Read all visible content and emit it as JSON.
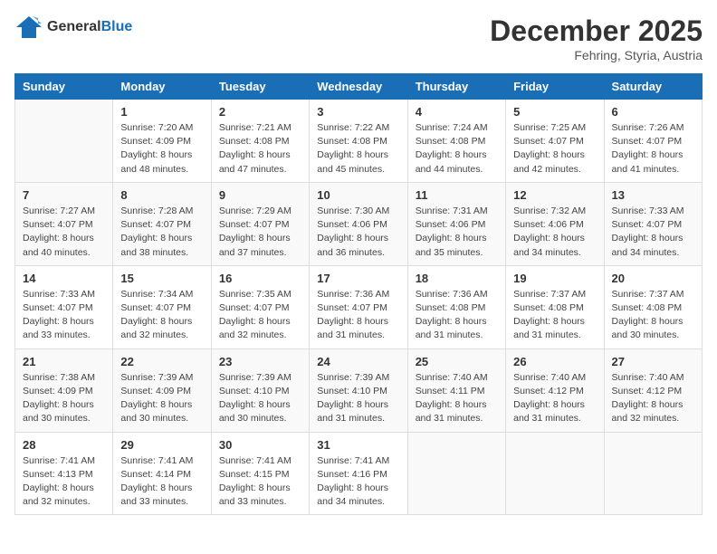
{
  "logo": {
    "general": "General",
    "blue": "Blue"
  },
  "title": "December 2025",
  "location": "Fehring, Styria, Austria",
  "days_header": [
    "Sunday",
    "Monday",
    "Tuesday",
    "Wednesday",
    "Thursday",
    "Friday",
    "Saturday"
  ],
  "weeks": [
    [
      {
        "num": "",
        "sunrise": "",
        "sunset": "",
        "daylight": ""
      },
      {
        "num": "1",
        "sunrise": "Sunrise: 7:20 AM",
        "sunset": "Sunset: 4:09 PM",
        "daylight": "Daylight: 8 hours and 48 minutes."
      },
      {
        "num": "2",
        "sunrise": "Sunrise: 7:21 AM",
        "sunset": "Sunset: 4:08 PM",
        "daylight": "Daylight: 8 hours and 47 minutes."
      },
      {
        "num": "3",
        "sunrise": "Sunrise: 7:22 AM",
        "sunset": "Sunset: 4:08 PM",
        "daylight": "Daylight: 8 hours and 45 minutes."
      },
      {
        "num": "4",
        "sunrise": "Sunrise: 7:24 AM",
        "sunset": "Sunset: 4:08 PM",
        "daylight": "Daylight: 8 hours and 44 minutes."
      },
      {
        "num": "5",
        "sunrise": "Sunrise: 7:25 AM",
        "sunset": "Sunset: 4:07 PM",
        "daylight": "Daylight: 8 hours and 42 minutes."
      },
      {
        "num": "6",
        "sunrise": "Sunrise: 7:26 AM",
        "sunset": "Sunset: 4:07 PM",
        "daylight": "Daylight: 8 hours and 41 minutes."
      }
    ],
    [
      {
        "num": "7",
        "sunrise": "Sunrise: 7:27 AM",
        "sunset": "Sunset: 4:07 PM",
        "daylight": "Daylight: 8 hours and 40 minutes."
      },
      {
        "num": "8",
        "sunrise": "Sunrise: 7:28 AM",
        "sunset": "Sunset: 4:07 PM",
        "daylight": "Daylight: 8 hours and 38 minutes."
      },
      {
        "num": "9",
        "sunrise": "Sunrise: 7:29 AM",
        "sunset": "Sunset: 4:07 PM",
        "daylight": "Daylight: 8 hours and 37 minutes."
      },
      {
        "num": "10",
        "sunrise": "Sunrise: 7:30 AM",
        "sunset": "Sunset: 4:06 PM",
        "daylight": "Daylight: 8 hours and 36 minutes."
      },
      {
        "num": "11",
        "sunrise": "Sunrise: 7:31 AM",
        "sunset": "Sunset: 4:06 PM",
        "daylight": "Daylight: 8 hours and 35 minutes."
      },
      {
        "num": "12",
        "sunrise": "Sunrise: 7:32 AM",
        "sunset": "Sunset: 4:06 PM",
        "daylight": "Daylight: 8 hours and 34 minutes."
      },
      {
        "num": "13",
        "sunrise": "Sunrise: 7:33 AM",
        "sunset": "Sunset: 4:07 PM",
        "daylight": "Daylight: 8 hours and 34 minutes."
      }
    ],
    [
      {
        "num": "14",
        "sunrise": "Sunrise: 7:33 AM",
        "sunset": "Sunset: 4:07 PM",
        "daylight": "Daylight: 8 hours and 33 minutes."
      },
      {
        "num": "15",
        "sunrise": "Sunrise: 7:34 AM",
        "sunset": "Sunset: 4:07 PM",
        "daylight": "Daylight: 8 hours and 32 minutes."
      },
      {
        "num": "16",
        "sunrise": "Sunrise: 7:35 AM",
        "sunset": "Sunset: 4:07 PM",
        "daylight": "Daylight: 8 hours and 32 minutes."
      },
      {
        "num": "17",
        "sunrise": "Sunrise: 7:36 AM",
        "sunset": "Sunset: 4:07 PM",
        "daylight": "Daylight: 8 hours and 31 minutes."
      },
      {
        "num": "18",
        "sunrise": "Sunrise: 7:36 AM",
        "sunset": "Sunset: 4:08 PM",
        "daylight": "Daylight: 8 hours and 31 minutes."
      },
      {
        "num": "19",
        "sunrise": "Sunrise: 7:37 AM",
        "sunset": "Sunset: 4:08 PM",
        "daylight": "Daylight: 8 hours and 31 minutes."
      },
      {
        "num": "20",
        "sunrise": "Sunrise: 7:37 AM",
        "sunset": "Sunset: 4:08 PM",
        "daylight": "Daylight: 8 hours and 30 minutes."
      }
    ],
    [
      {
        "num": "21",
        "sunrise": "Sunrise: 7:38 AM",
        "sunset": "Sunset: 4:09 PM",
        "daylight": "Daylight: 8 hours and 30 minutes."
      },
      {
        "num": "22",
        "sunrise": "Sunrise: 7:39 AM",
        "sunset": "Sunset: 4:09 PM",
        "daylight": "Daylight: 8 hours and 30 minutes."
      },
      {
        "num": "23",
        "sunrise": "Sunrise: 7:39 AM",
        "sunset": "Sunset: 4:10 PM",
        "daylight": "Daylight: 8 hours and 30 minutes."
      },
      {
        "num": "24",
        "sunrise": "Sunrise: 7:39 AM",
        "sunset": "Sunset: 4:10 PM",
        "daylight": "Daylight: 8 hours and 31 minutes."
      },
      {
        "num": "25",
        "sunrise": "Sunrise: 7:40 AM",
        "sunset": "Sunset: 4:11 PM",
        "daylight": "Daylight: 8 hours and 31 minutes."
      },
      {
        "num": "26",
        "sunrise": "Sunrise: 7:40 AM",
        "sunset": "Sunset: 4:12 PM",
        "daylight": "Daylight: 8 hours and 31 minutes."
      },
      {
        "num": "27",
        "sunrise": "Sunrise: 7:40 AM",
        "sunset": "Sunset: 4:12 PM",
        "daylight": "Daylight: 8 hours and 32 minutes."
      }
    ],
    [
      {
        "num": "28",
        "sunrise": "Sunrise: 7:41 AM",
        "sunset": "Sunset: 4:13 PM",
        "daylight": "Daylight: 8 hours and 32 minutes."
      },
      {
        "num": "29",
        "sunrise": "Sunrise: 7:41 AM",
        "sunset": "Sunset: 4:14 PM",
        "daylight": "Daylight: 8 hours and 33 minutes."
      },
      {
        "num": "30",
        "sunrise": "Sunrise: 7:41 AM",
        "sunset": "Sunset: 4:15 PM",
        "daylight": "Daylight: 8 hours and 33 minutes."
      },
      {
        "num": "31",
        "sunrise": "Sunrise: 7:41 AM",
        "sunset": "Sunset: 4:16 PM",
        "daylight": "Daylight: 8 hours and 34 minutes."
      },
      {
        "num": "",
        "sunrise": "",
        "sunset": "",
        "daylight": ""
      },
      {
        "num": "",
        "sunrise": "",
        "sunset": "",
        "daylight": ""
      },
      {
        "num": "",
        "sunrise": "",
        "sunset": "",
        "daylight": ""
      }
    ]
  ]
}
